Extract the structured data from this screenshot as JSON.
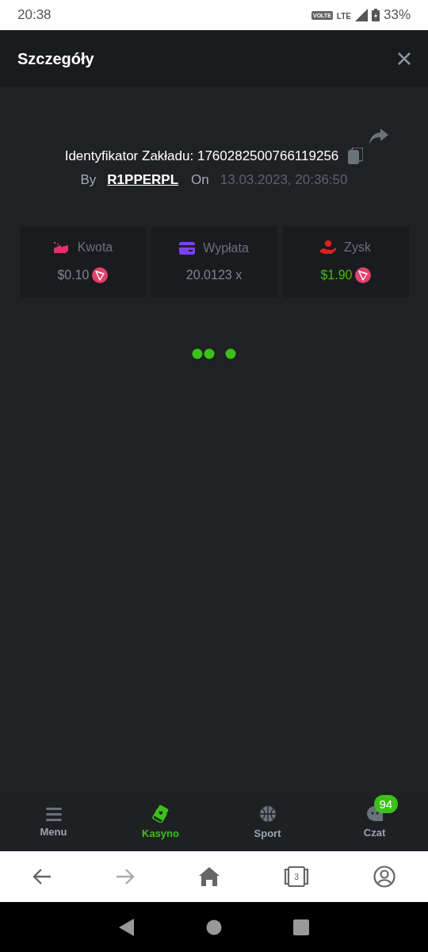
{
  "status_bar": {
    "time": "20:38",
    "network_badge": "VOLTE",
    "network_type": "LTE",
    "battery": "33%"
  },
  "header": {
    "title": "Szczegóły"
  },
  "bet": {
    "id_label": "Identyfikator Zakładu: 1760282500766119256",
    "by_label": "By",
    "user": "R1PPERPL",
    "on_label": "On",
    "date": "13.03.2023, 20:36:50"
  },
  "stats": [
    {
      "kind": "amount",
      "label": "Kwota",
      "value": "$0.10",
      "coin": true
    },
    {
      "kind": "payout",
      "label": "Wypłata",
      "value": "20.0123 x",
      "coin": false
    },
    {
      "kind": "profit",
      "label": "Zysk",
      "value": "$1.90",
      "coin": true
    }
  ],
  "bottom_nav": [
    {
      "kind": "menu",
      "label": "Menu",
      "selected": false
    },
    {
      "kind": "casino",
      "label": "Kasyno",
      "selected": true
    },
    {
      "kind": "sport",
      "label": "Sport",
      "selected": false
    },
    {
      "kind": "chat",
      "label": "Czat",
      "selected": false,
      "badge": "94"
    }
  ],
  "browser_bar": {
    "back_disabled": false,
    "forward_disabled": true,
    "tab_count": "3"
  }
}
